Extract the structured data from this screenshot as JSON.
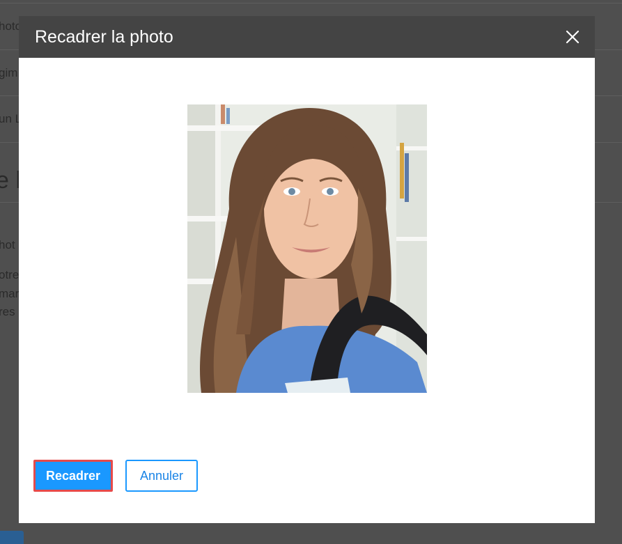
{
  "background": {
    "fragments": [
      "hoto",
      "gim",
      "un L",
      "e l",
      "hot",
      "otre",
      "mar",
      "res"
    ]
  },
  "modal": {
    "title": "Recadrer la photo",
    "close_icon": "close-icon",
    "photo_description": "Portrait photo of a young woman with long brown hair wearing a blue top and a backpack",
    "buttons": {
      "crop_label": "Recadrer",
      "cancel_label": "Annuler"
    }
  },
  "colors": {
    "header_bg": "#444444",
    "primary": "#1a98ff",
    "highlight_border": "#e64a4a",
    "overlay": "#4f4f4f"
  }
}
